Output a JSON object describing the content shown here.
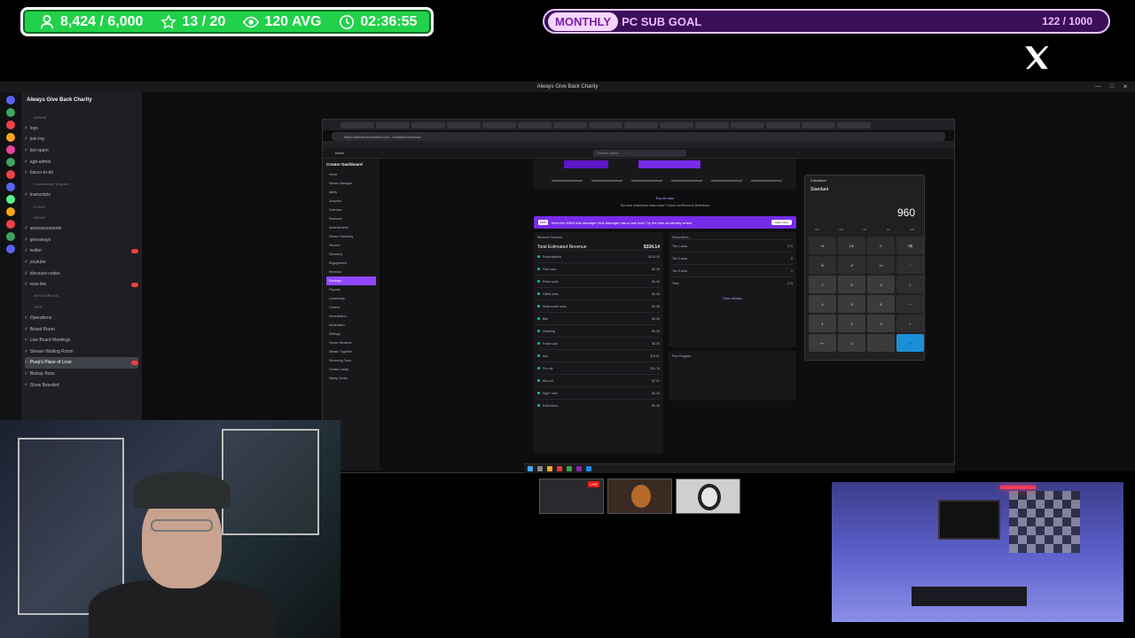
{
  "stats": {
    "followers": "8,424 / 6,000",
    "level": "13 / 20",
    "viewers": "120 AVG",
    "timer": "02:36:55"
  },
  "goal": {
    "pill": "MONTHLY",
    "label": "PC SUB GOAL",
    "count": "122 / 1000"
  },
  "capture": {
    "window_title": "Always Give Back Charity"
  },
  "discord": {
    "server_name": "Always Give Back Charity",
    "channels": [
      {
        "type": "category",
        "label": "ADMIN"
      },
      {
        "type": "channel",
        "label": "logs"
      },
      {
        "type": "channel",
        "label": "join-log"
      },
      {
        "type": "channel",
        "label": "bot-spam"
      },
      {
        "type": "channel",
        "label": "agb-admin"
      },
      {
        "type": "channel",
        "label": "falcon-to-do"
      },
      {
        "type": "category",
        "label": "Community Support"
      },
      {
        "type": "channel",
        "label": "transcripts"
      },
      {
        "type": "category",
        "label": "STAFF"
      },
      {
        "type": "category",
        "label": "NEWS"
      },
      {
        "type": "channel",
        "label": "announcements"
      },
      {
        "type": "channel",
        "label": "giveaways"
      },
      {
        "type": "channel",
        "label": "twitter",
        "badge": true
      },
      {
        "type": "channel",
        "label": "youtube"
      },
      {
        "type": "channel",
        "label": "discount-codes"
      },
      {
        "type": "channel",
        "label": "now-live",
        "badge": true
      },
      {
        "type": "category",
        "label": "RESOURCES"
      },
      {
        "type": "category",
        "label": "OPS"
      },
      {
        "type": "channel",
        "label": "Operations"
      },
      {
        "type": "channel",
        "label": "Board Room"
      },
      {
        "type": "channel",
        "label": "Live Board Meetings"
      },
      {
        "type": "channel",
        "label": "Stream Waiting Room"
      },
      {
        "type": "channel",
        "label": "Peep's Place of Love",
        "active": true,
        "badge": true
      },
      {
        "type": "channel",
        "label": "Bishop Boss"
      },
      {
        "type": "channel",
        "label": "Show Bearded"
      }
    ]
  },
  "browser": {
    "url": "https://dashboard.twitch.tv/u/.../analytics/revenue",
    "brand": "twitch",
    "search_placeholder": "Channel Search"
  },
  "creator_sidebar": {
    "title": "Creator Dashboard",
    "items": [
      {
        "label": "Home"
      },
      {
        "label": "Stream Manager"
      },
      {
        "label": "Alerts"
      },
      {
        "label": "Analytics"
      },
      {
        "label": "Overview"
      },
      {
        "label": "Research"
      },
      {
        "label": "Achievements"
      },
      {
        "label": "Stream Summary"
      },
      {
        "label": "Viewers"
      },
      {
        "label": "Discovery"
      },
      {
        "label": "Engagement"
      },
      {
        "label": "Revenue"
      },
      {
        "label": "Earnings",
        "active": true
      },
      {
        "label": "Payouts"
      },
      {
        "label": "Community"
      },
      {
        "label": "Content"
      },
      {
        "label": "Monetization"
      },
      {
        "label": "Moderation"
      },
      {
        "label": "Settings"
      },
      {
        "label": "Viewer Rewards"
      },
      {
        "label": "Stream Together"
      },
      {
        "label": "Streaming Tools"
      },
      {
        "label": "Creator Camp"
      },
      {
        "label": "Safety Center"
      }
    ]
  },
  "revenue": {
    "export_link": "Export data",
    "notice": "Not sure what these stats mean? Check out Revenue Definitions",
    "ads_new": "NEW",
    "ads_text": "Meet the NEW Ads Manager! Ads Manager has a new look! Try the new ad density wheel",
    "ads_learn": "Learn more",
    "left_title": "Revenue Sources",
    "total_label": "Total Estimated Revenue",
    "total_value": "$334.14",
    "lines": [
      {
        "label": "Subscriptions",
        "value": "$314.43"
      },
      {
        "label": "Paid subs",
        "value": "$0.00"
      },
      {
        "label": "Prime subs",
        "value": "$0.00"
      },
      {
        "label": "Gifted subs",
        "value": "$0.00"
      },
      {
        "label": "Multi-month subs",
        "value": "$0.00"
      },
      {
        "label": "Bits",
        "value": "$0.00"
      },
      {
        "label": "Cheering",
        "value": "$0.00"
      },
      {
        "label": "Power-ups",
        "value": "$0.00"
      },
      {
        "label": "Ads",
        "value": "$19.67"
      },
      {
        "label": "Pre-roll",
        "value": "$11.76"
      },
      {
        "label": "Mid-roll",
        "value": "$7.91"
      },
      {
        "label": "Hype Train",
        "value": "$0.00"
      },
      {
        "label": "Extensions",
        "value": "$0.00"
      }
    ],
    "right_title": "Subscribers",
    "right_lines": [
      {
        "label": "Tier 1 subs",
        "value": "273"
      },
      {
        "label": "Tier 2 subs",
        "value": "0"
      },
      {
        "label": "Tier 3 subs",
        "value": "1"
      },
      {
        "label": "Total",
        "value": "274"
      }
    ],
    "plus_title": "Plus Program",
    "view_details": "View details"
  },
  "calculator": {
    "title": "Calculator",
    "mode": "Standard",
    "display": "960",
    "memory": [
      "MC",
      "MR",
      "M+",
      "M-",
      "MS"
    ],
    "keys": [
      "%",
      "CE",
      "C",
      "⌫",
      "⅟x",
      "x²",
      "√x",
      "÷",
      "7",
      "8",
      "9",
      "×",
      "4",
      "5",
      "6",
      "−",
      "1",
      "2",
      "3",
      "+",
      "+/−",
      "0",
      ".",
      "="
    ]
  },
  "thumbs": {
    "live_label": "LIVE"
  },
  "colors": {
    "stats_green": "#22d14a",
    "goal_purple": "#3a0f57",
    "twitch_purple": "#772ce8",
    "calc_equals": "#1b8fd6"
  }
}
